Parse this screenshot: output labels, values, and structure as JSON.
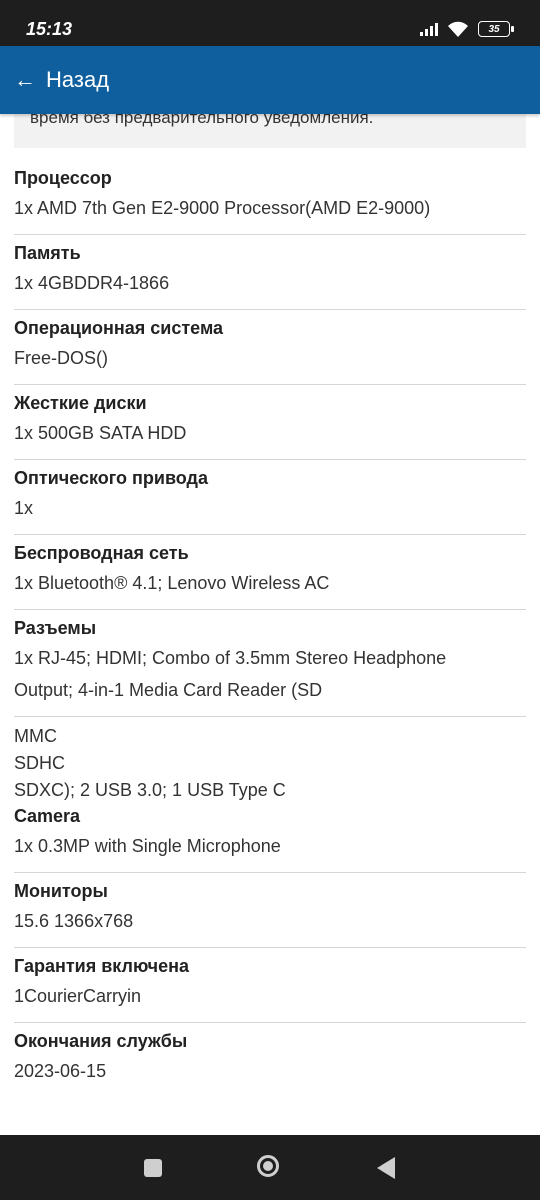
{
  "status": {
    "time": "15:13",
    "battery": "35"
  },
  "appbar": {
    "back_arrow": "←",
    "back_label": "Назад"
  },
  "notice": {
    "text": "время без предварительного уведомления."
  },
  "specs": [
    {
      "label": "Процессор",
      "value": "1x AMD 7th Gen E2-9000 Processor(AMD E2-9000)"
    },
    {
      "label": "Память",
      "value": "1x 4GBDDR4-1866"
    },
    {
      "label": "Операционная система",
      "value": "Free-DOS()"
    },
    {
      "label": "Жесткие диски",
      "value": "1x 500GB SATA HDD"
    },
    {
      "label": "Оптического привода",
      "value": "1x"
    },
    {
      "label": "Беспроводная сеть",
      "value": "1x Bluetooth® 4.1; Lenovo Wireless AC"
    },
    {
      "label": "Разъемы",
      "value_line1": "1x RJ-45; HDMI; Combo of 3.5mm Stereo Headphone",
      "value_line2": "Output; 4-in-1 Media Card Reader (SD"
    }
  ],
  "connector_extra": [
    "MMC",
    "SDHC",
    "SDXC); 2 USB 3.0; 1 USB Type C"
  ],
  "specs2": [
    {
      "label": "Camera",
      "value": "1x 0.3MP with Single Microphone"
    },
    {
      "label": "Мониторы",
      "value": "15.6 1366x768"
    },
    {
      "label": "Гарантия включена",
      "value": "1CourierCarryin"
    },
    {
      "label": "Окончания службы",
      "value": "2023-06-15"
    }
  ],
  "icons": {
    "signal": "signal-icon",
    "wifi": "wifi-icon",
    "battery": "battery-icon",
    "back": "arrow-left-icon",
    "nav_recents": "square-icon",
    "nav_home": "circle-icon",
    "nav_back": "triangle-back-icon"
  }
}
